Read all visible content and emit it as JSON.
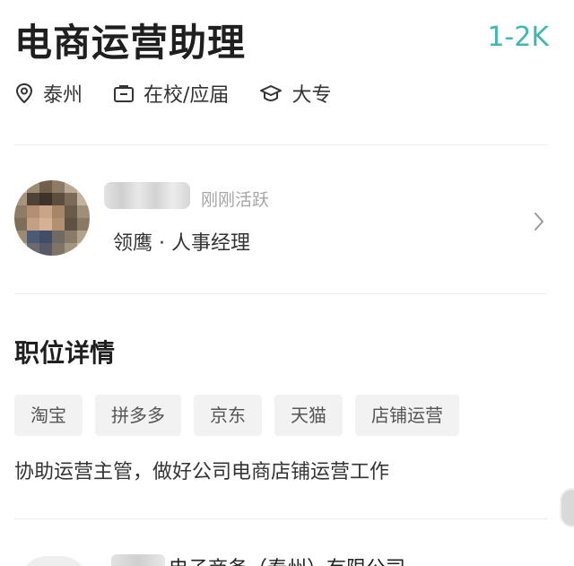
{
  "job": {
    "title": "电商运营助理",
    "salary": "1-2K",
    "location": "泰州",
    "experience": "在校/应届",
    "education": "大专"
  },
  "recruiter": {
    "active_status": "刚刚活跃",
    "role": "领鹰 · 人事经理"
  },
  "details": {
    "section_title": "职位详情",
    "tags": [
      "淘宝",
      "拼多多",
      "京东",
      "天猫",
      "店铺运营"
    ],
    "description": "协助运营主管，做好公司电商店铺运营工作"
  },
  "company": {
    "name_partial": "电子商务（泰州）有限公司"
  },
  "colors": {
    "salary": "#3fb6b4",
    "tag_bg": "#f2f2f2",
    "divider": "#ececec"
  },
  "icons": {
    "location": "location-pin-icon",
    "experience": "briefcase-icon",
    "education": "graduation-cap-icon",
    "chevron": "chevron-right-icon"
  }
}
